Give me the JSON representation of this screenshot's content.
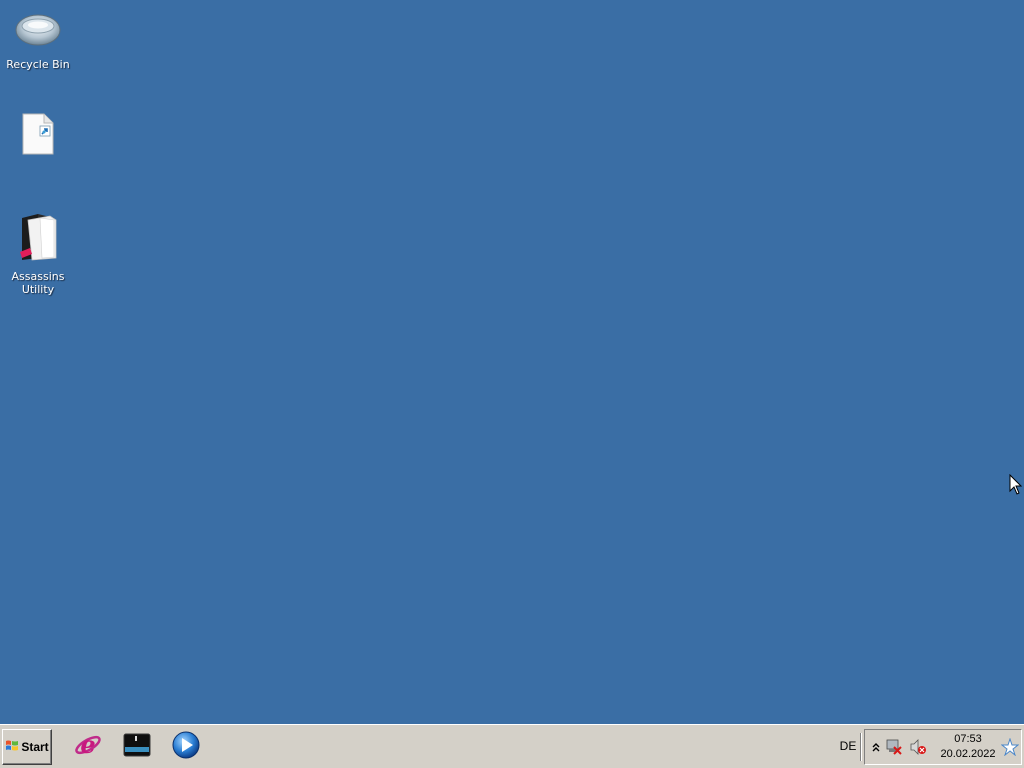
{
  "desktop": {
    "background_color": "#3a6ea5",
    "icons": [
      {
        "label": "Recycle Bin",
        "icon": "recycle-bin-icon"
      },
      {
        "label": "",
        "icon": "shortcut-document-icon"
      },
      {
        "label": "Assassins Utility",
        "icon": "folder-utility-icon"
      }
    ]
  },
  "taskbar": {
    "start_label": "Start",
    "quick_launch": [
      {
        "icon": "internet-explorer-icon"
      },
      {
        "icon": "show-desktop-icon"
      },
      {
        "icon": "media-player-icon"
      }
    ],
    "language": "DE",
    "tray": {
      "icons": [
        "show-hidden-icons-chevron",
        "network-disconnected-icon",
        "volume-muted-icon",
        "notification-star-icon"
      ],
      "time": "07:53",
      "date": "20.02.2022"
    }
  }
}
